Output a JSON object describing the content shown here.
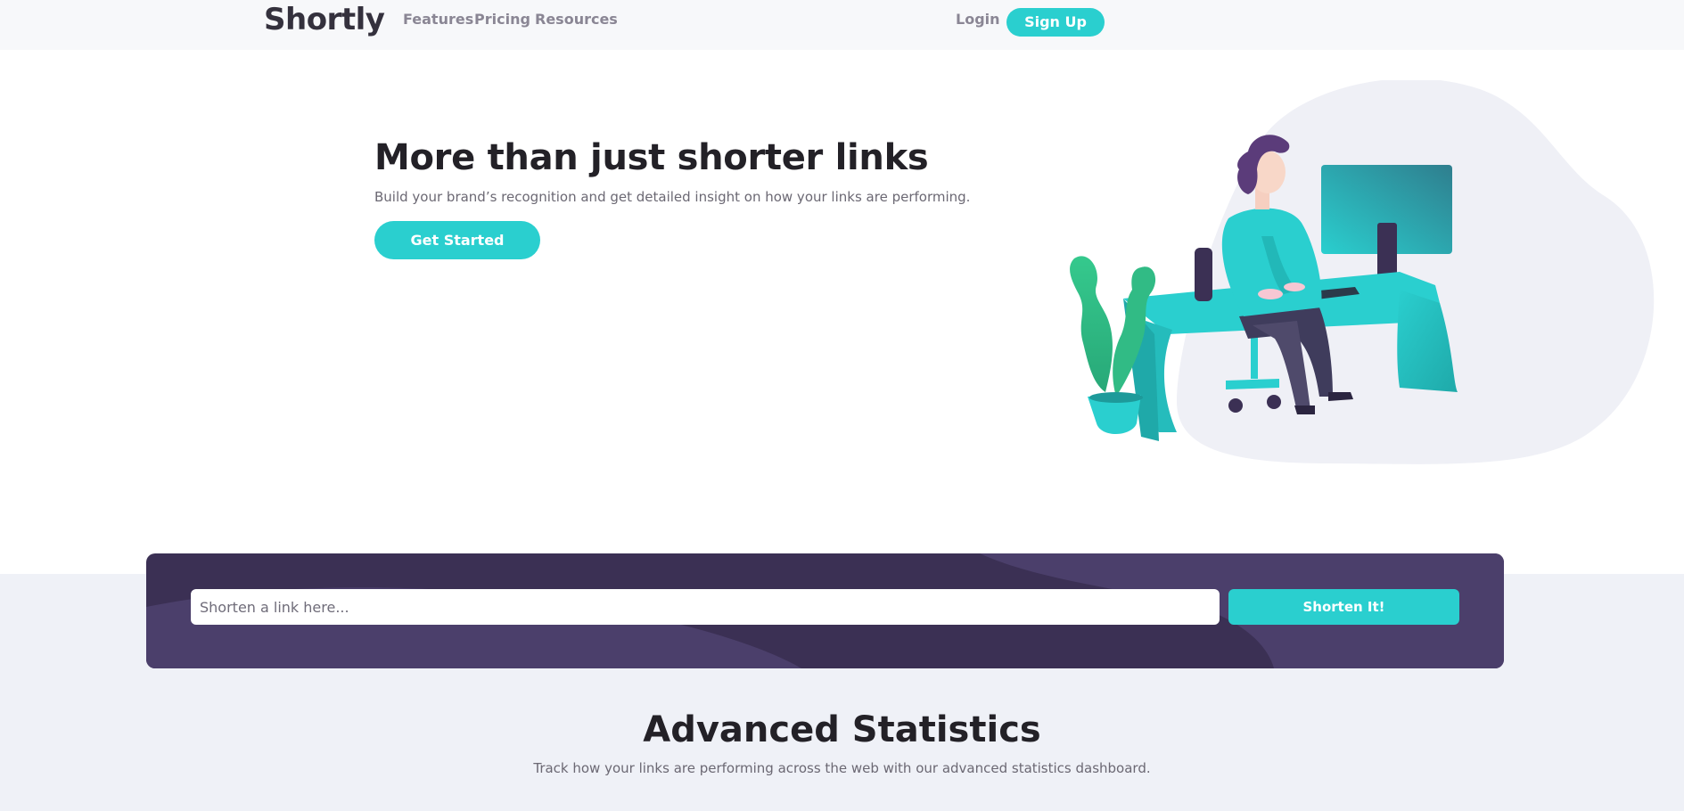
{
  "nav": {
    "logo": "Shortly",
    "links": [
      "Features",
      "Pricing",
      "Resources"
    ],
    "login": "Login",
    "signup": "Sign Up"
  },
  "hero": {
    "title": "More than just shorter links",
    "subtitle": "Build your brand’s recognition and get detailed insight on how your links are performing.",
    "cta": "Get Started",
    "illustration": "person-working-at-desk-illustration"
  },
  "shorten": {
    "placeholder": "Shorten a link here...",
    "button": "Shorten It!"
  },
  "stats": {
    "title": "Advanced Statistics",
    "subtitle": "Track how your links are performing across the web with our advanced statistics dashboard."
  },
  "colors": {
    "primary": "#2acfcf",
    "dark_violet": "#3b3054",
    "grayish_violet": "#9e9aa7",
    "light_bg": "#eff1f7"
  }
}
